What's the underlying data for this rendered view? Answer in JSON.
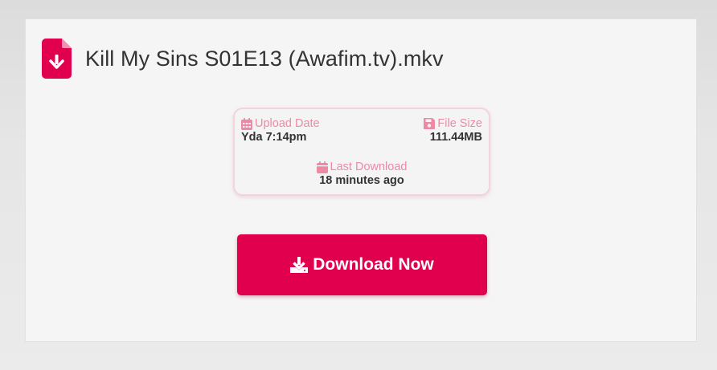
{
  "file": {
    "title": "Kill My Sins S01E13 (Awafim.tv).mkv",
    "icon": "file-download-icon"
  },
  "info": {
    "upload_label": "Upload Date",
    "upload_value": "Yda 7:14pm",
    "size_label": "File Size",
    "size_value": "111.44MB",
    "last_label": "Last Download",
    "last_value": "18 minutes ago"
  },
  "actions": {
    "download_label": "Download Now"
  },
  "colors": {
    "accent": "#e0004d",
    "label_pink": "#ec8aa5",
    "border_pink": "#f3d3dc"
  }
}
